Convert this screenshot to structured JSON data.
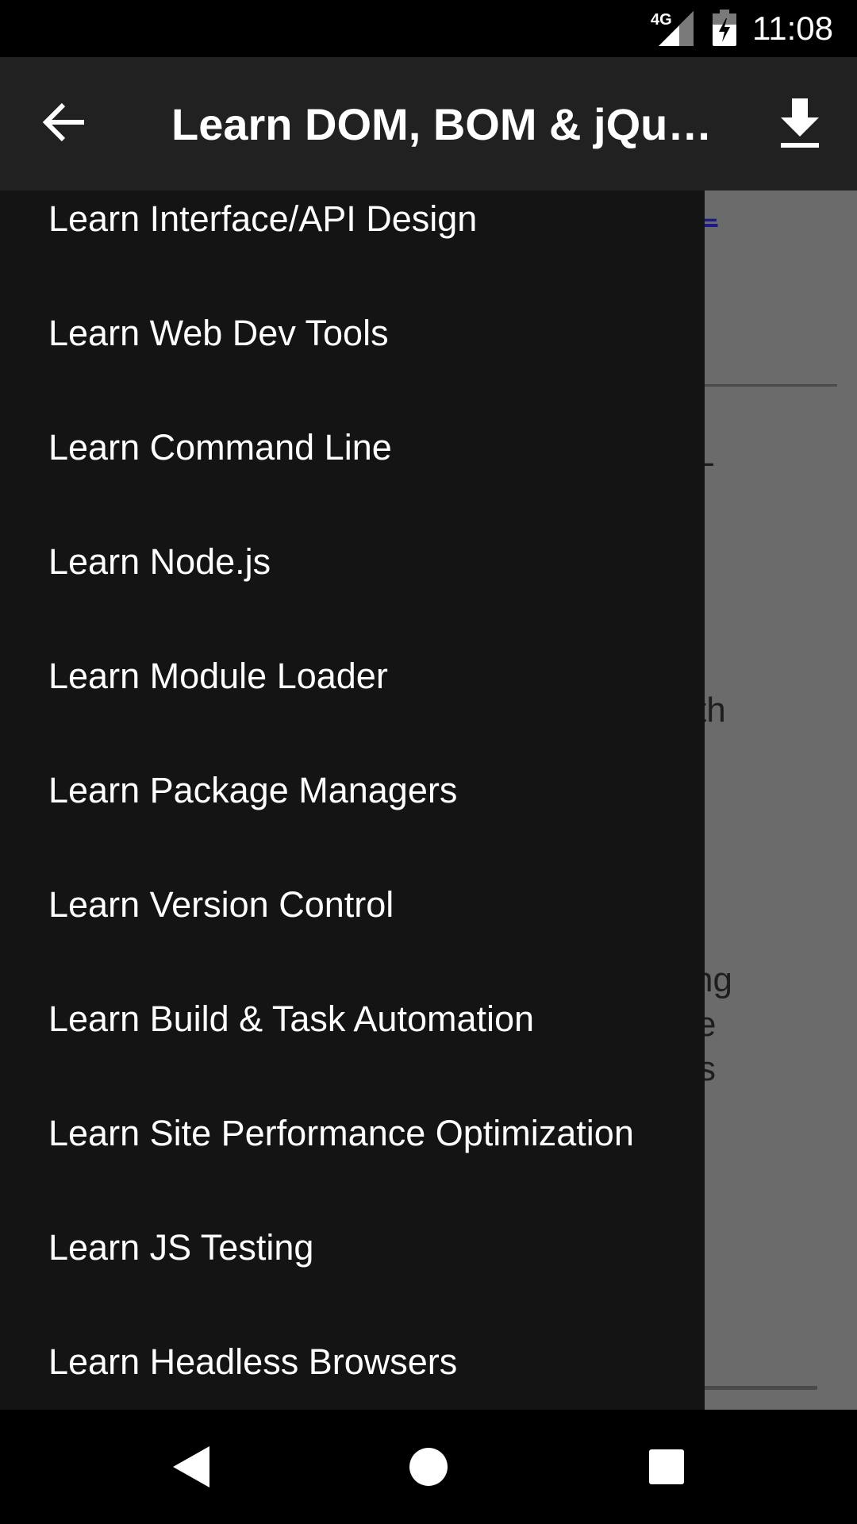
{
  "status_bar": {
    "network": "4G",
    "clock": "11:08",
    "icons": [
      "signal-icon",
      "battery-charging-icon"
    ]
  },
  "app_bar": {
    "title": "Learn DOM, BOM & jQue…",
    "back_icon": "arrow-back-icon",
    "download_icon": "download-icon"
  },
  "background_content": {
    "link_fragment": "L",
    "text_fragments": [
      "L",
      "]",
      "th",
      "ng",
      "e",
      "s"
    ]
  },
  "drawer": {
    "items": [
      {
        "label": "Learn Interface/API Design"
      },
      {
        "label": "Learn Web Dev Tools"
      },
      {
        "label": "Learn Command Line"
      },
      {
        "label": "Learn Node.js"
      },
      {
        "label": "Learn Module Loader"
      },
      {
        "label": "Learn Package Managers"
      },
      {
        "label": "Learn Version Control"
      },
      {
        "label": "Learn Build & Task Automation"
      },
      {
        "label": "Learn Site Performance Optimization"
      },
      {
        "label": "Learn JS Testing"
      },
      {
        "label": "Learn Headless Browsers"
      }
    ]
  },
  "nav_bar": {
    "icons": [
      "nav-back-icon",
      "nav-home-icon",
      "nav-recents-icon"
    ]
  }
}
